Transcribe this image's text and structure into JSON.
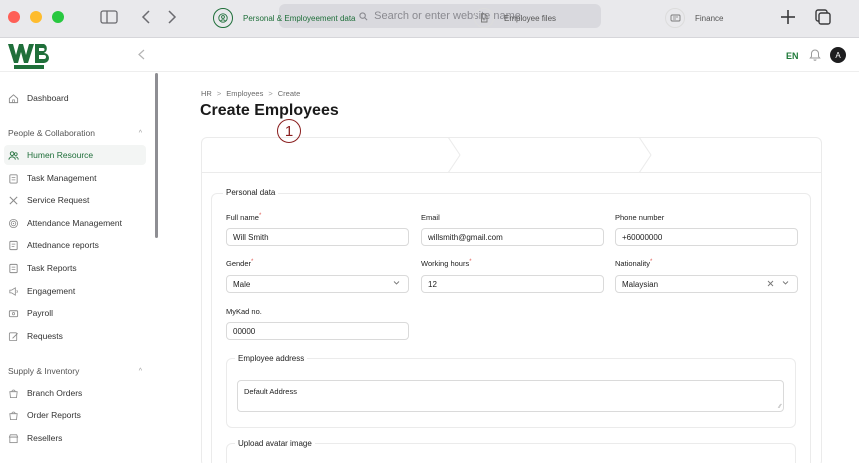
{
  "browser": {
    "address_placeholder": "Search or enter website name"
  },
  "header": {
    "logo_text": "WB",
    "language": "EN",
    "avatar_initial": "A"
  },
  "sidebar": {
    "dashboard": "Dashboard",
    "section_people": "People & Collaboration",
    "people_items": [
      "Humen Resource",
      "Task Management",
      "Service Request",
      "Attendance Management",
      "Attednance reports",
      "Task Reports",
      "Engagement",
      "Payroll",
      "Requests"
    ],
    "section_supply": "Supply & Inventory",
    "supply_items": [
      "Branch Orders",
      "Order Reports",
      "Resellers"
    ]
  },
  "breadcrumb": [
    "HR",
    "Employees",
    "Create"
  ],
  "page_title": "Create Employees",
  "step_marker": "1",
  "steps": [
    "Personal & Employeement data",
    "Employee files",
    "Finance"
  ],
  "form": {
    "legend_personal": "Personal data",
    "full_name_label": "Full name",
    "full_name_value": "Will Smith",
    "email_label": "Email",
    "email_value": "willsmith@gmail.com",
    "phone_label": "Phone number",
    "phone_value": "+60000000",
    "gender_label": "Gender",
    "gender_value": "Male",
    "hours_label": "Working hours",
    "hours_value": "12",
    "nationality_label": "Nationality",
    "nationality_value": "Malaysian",
    "mykad_label": "MyKad no.",
    "mykad_value": "00000",
    "address_legend": "Employee address",
    "address_value": "Default Address",
    "avatar_legend": "Upload avatar image",
    "required_mark": "*"
  },
  "colors": {
    "brand_green": "#1f6f3a",
    "required_red": "#e0574f"
  }
}
